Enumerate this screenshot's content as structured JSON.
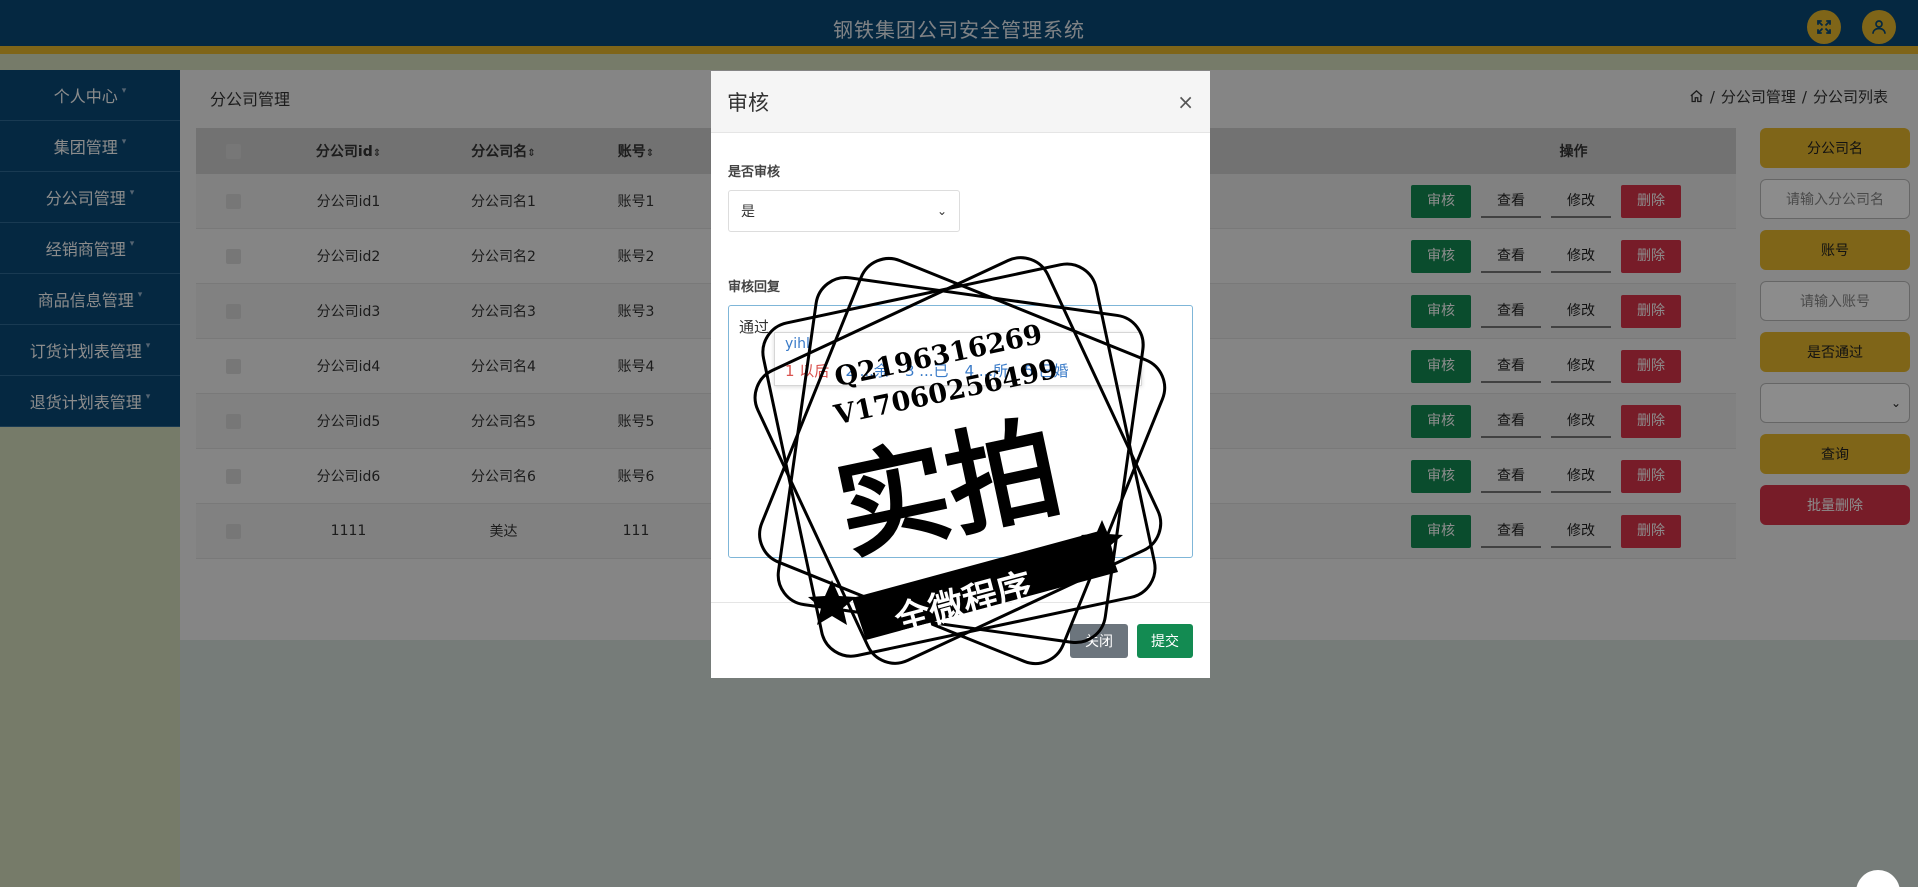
{
  "header": {
    "title": "钢铁集团公司安全管理系统",
    "fullscreen_icon": "fullscreen-icon",
    "user_icon": "user-icon"
  },
  "sidebar": {
    "items": [
      {
        "label": "个人中心"
      },
      {
        "label": "集团管理"
      },
      {
        "label": "分公司管理"
      },
      {
        "label": "经销商管理"
      },
      {
        "label": "商品信息管理"
      },
      {
        "label": "订货计划表管理"
      },
      {
        "label": "退货计划表管理"
      }
    ]
  },
  "page": {
    "title": "分公司管理",
    "breadcrumb": [
      "分公司管理",
      "分公司列表"
    ],
    "breadcrumb_sep": "/"
  },
  "table": {
    "headers": {
      "id": "分公司id",
      "name": "分公司名",
      "account": "账号",
      "ops": "操作"
    },
    "sort_glyph": "⇕",
    "ops": {
      "review": "审核",
      "view": "查看",
      "edit": "修改",
      "delete": "删除"
    },
    "rows": [
      {
        "id": "分公司id1",
        "name": "分公司名1",
        "account": "账号1"
      },
      {
        "id": "分公司id2",
        "name": "分公司名2",
        "account": "账号2"
      },
      {
        "id": "分公司id3",
        "name": "分公司名3",
        "account": "账号3"
      },
      {
        "id": "分公司id4",
        "name": "分公司名4",
        "account": "账号4"
      },
      {
        "id": "分公司id5",
        "name": "分公司名5",
        "account": "账号5"
      },
      {
        "id": "分公司id6",
        "name": "分公司名6",
        "account": "账号6"
      },
      {
        "id": "1111",
        "name": "美达",
        "account": "111"
      }
    ]
  },
  "search": {
    "name_label": "分公司名",
    "name_placeholder": "请输入分公司名",
    "account_label": "账号",
    "account_placeholder": "请输入账号",
    "passed_label": "是否通过",
    "passed_value": "",
    "query_button": "查询",
    "batch_delete_button": "批量删除"
  },
  "modal": {
    "title": "审核",
    "close_glyph": "×",
    "review_label": "是否审核",
    "review_value": "是",
    "reply_label": "审核回复",
    "reply_value": "通过",
    "close_button": "关闭",
    "submit_button": "提交"
  },
  "ime": {
    "pinyin": "yihl",
    "candidates": [
      "1 以后",
      "2 ...余",
      "3 ...已",
      "4 ...所",
      "5 已婚"
    ]
  },
  "watermark": {
    "line1": "Q2196316269",
    "line2": "V17060256499",
    "big": "实拍",
    "ribbon": "全微程序"
  }
}
